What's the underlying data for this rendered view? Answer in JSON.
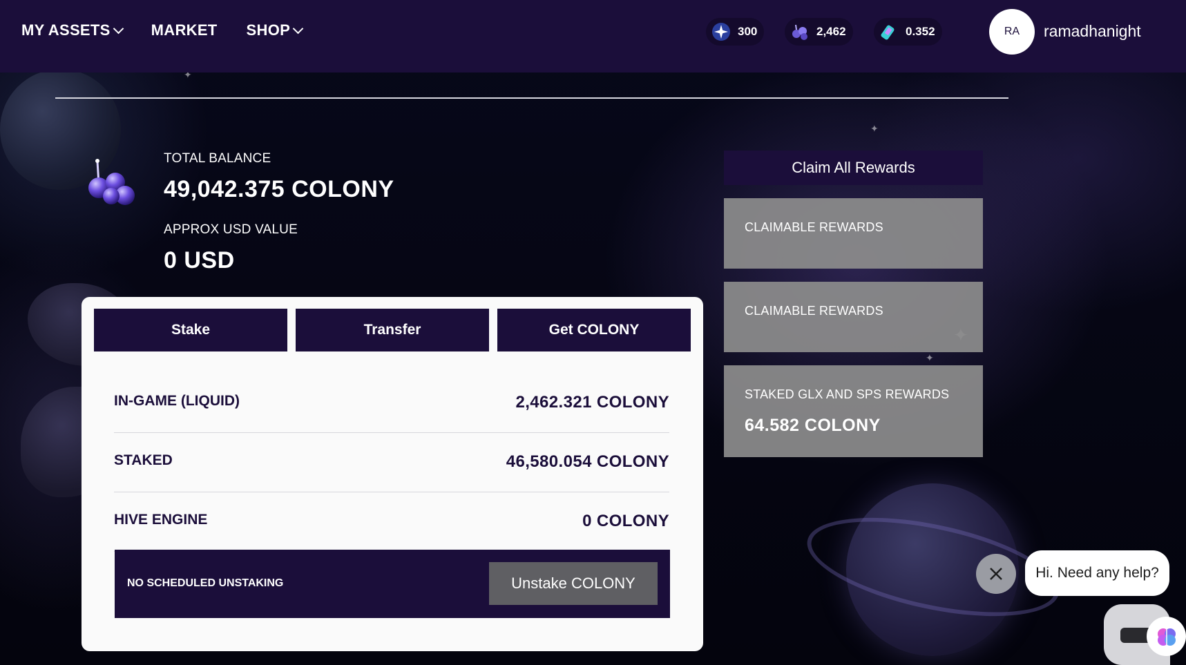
{
  "nav": {
    "my_assets": "MY ASSETS",
    "market": "MARKET",
    "shop": "SHOP"
  },
  "wallet": {
    "pills": [
      {
        "icon": "star-icon",
        "value": "300"
      },
      {
        "icon": "colony-coin-icon",
        "value": "2,462"
      },
      {
        "icon": "ticket-icon",
        "value": "0.352"
      }
    ]
  },
  "user": {
    "initials": "RA",
    "name": "ramadhanight"
  },
  "balance": {
    "total_label": "TOTAL BALANCE",
    "total_value": "49,042.375 COLONY",
    "usd_label": "APPROX USD VALUE",
    "usd_value": "0 USD"
  },
  "actions": {
    "stake": "Stake",
    "transfer": "Transfer",
    "get": "Get COLONY"
  },
  "holdings": [
    {
      "label": "IN-GAME (LIQUID)",
      "value": "2,462.321 COLONY"
    },
    {
      "label": "STAKED",
      "value": "46,580.054 COLONY"
    },
    {
      "label": "HIVE ENGINE",
      "value": "0 COLONY"
    }
  ],
  "unstaking": {
    "status": "NO SCHEDULED UNSTAKING",
    "button": "Unstake COLONY"
  },
  "rewards": {
    "claim_all": "Claim All Rewards",
    "boxes": [
      {
        "title": "CLAIMABLE REWARDS",
        "value": ""
      },
      {
        "title": "CLAIMABLE REWARDS",
        "value": ""
      },
      {
        "title": "STAKED GLX AND SPS REWARDS",
        "value": "64.582 COLONY"
      }
    ]
  },
  "chat": {
    "greeting": "Hi. Need any help?"
  },
  "colors": {
    "brand": "#1b0e3a",
    "card_bg": "#fafafa",
    "reward_box": "#8c8c8c"
  }
}
